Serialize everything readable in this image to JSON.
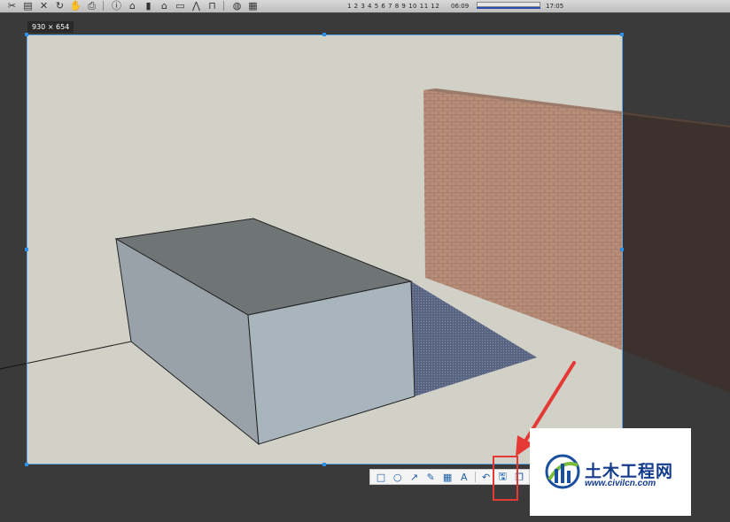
{
  "toolbar": {
    "icons": [
      "scissors-icon",
      "paint-icon",
      "erase-icon",
      "orbit-icon",
      "walk-icon",
      "print-icon",
      "info-icon",
      "house-icon",
      "door-icon",
      "home-icon",
      "window-icon",
      "roof-icon",
      "chair-icon",
      "globe-icon",
      "map-icon"
    ],
    "shadow_months": "1 2 3 4 5 6 7 8 9 10 11 12",
    "shadow_time_start": "06:09",
    "shadow_time_end": "17:05"
  },
  "scene": {
    "colors": {
      "background": "#d2d1c8",
      "box_top": "#6f7475",
      "box_left": "#99a2a8",
      "box_right": "#a9b5bd",
      "wall": "#b88e79",
      "shadow": "#59647f"
    }
  },
  "selection": {
    "size_label": "930 × 654"
  },
  "capture_toolbar": {
    "buttons": [
      {
        "name": "rectangle-tool-icon",
        "glyph": "□"
      },
      {
        "name": "ellipse-tool-icon",
        "glyph": "○"
      },
      {
        "name": "arrow-tool-icon",
        "glyph": "↗"
      },
      {
        "name": "pen-tool-icon",
        "glyph": "✎"
      },
      {
        "name": "mosaic-tool-icon",
        "glyph": "▦"
      },
      {
        "name": "text-tool-icon",
        "glyph": "A"
      },
      {
        "name": "undo-icon",
        "glyph": "↶"
      },
      {
        "name": "save-icon",
        "glyph": "🖫"
      },
      {
        "name": "copy-icon",
        "glyph": "❐"
      }
    ]
  },
  "watermark": {
    "title": "土木工程网",
    "url": "www.civilcn.com"
  }
}
